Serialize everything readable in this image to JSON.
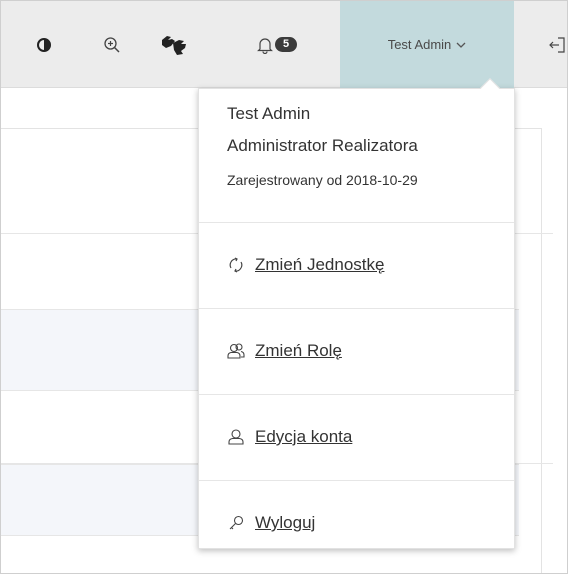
{
  "topbar": {
    "notifications_count": "5",
    "user_label": "Test Admin"
  },
  "user_dropdown": {
    "name": "Test Admin",
    "role": "Administrator Realizatora",
    "registered": "Zarejestrowany od 2018-10-29",
    "items": [
      {
        "label": "Zmień Jednostkę",
        "icon": "refresh-icon"
      },
      {
        "label": "Zmień Rolę",
        "icon": "users-icon"
      },
      {
        "label": "Edycja konta",
        "icon": "user-icon"
      },
      {
        "label": "Wyloguj",
        "icon": "key-icon"
      }
    ]
  },
  "colors": {
    "topbar_bg": "#ececec",
    "user_menu_bg": "#c3dadd",
    "badge_bg": "#3b3b3b"
  }
}
